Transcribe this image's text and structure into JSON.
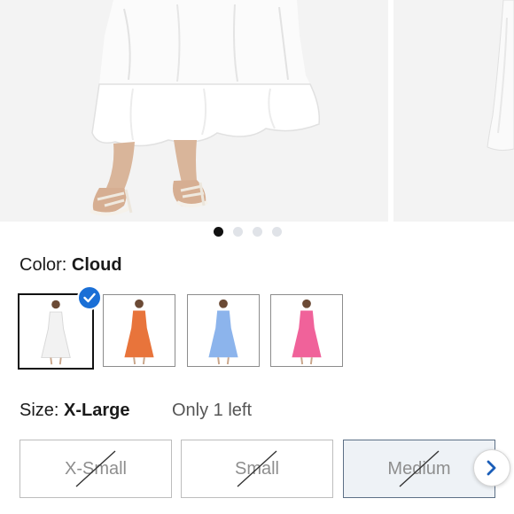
{
  "gallery": {
    "dots": [
      {
        "active": true
      },
      {
        "active": false
      },
      {
        "active": false
      },
      {
        "active": false
      }
    ]
  },
  "color": {
    "label": "Color:",
    "value": "Cloud",
    "swatches": [
      {
        "name": "Cloud",
        "color": "#f2f2f2",
        "selected": true
      },
      {
        "name": "Orange",
        "color": "#e8743b",
        "selected": false
      },
      {
        "name": "Blue",
        "color": "#8cb4ec",
        "selected": false
      },
      {
        "name": "Pink",
        "color": "#f0629a",
        "selected": false
      }
    ]
  },
  "size": {
    "label": "Size:",
    "value": "X-Large",
    "stock_note": "Only 1 left",
    "options": [
      {
        "label": "X-Small",
        "unavailable": true,
        "selected": false
      },
      {
        "label": "Small",
        "unavailable": true,
        "selected": false
      },
      {
        "label": "Medium",
        "unavailable": true,
        "selected": true
      }
    ]
  },
  "icons": {
    "check": "check-icon",
    "next": "chevron-right-icon"
  },
  "colors": {
    "accent": "#1a6fd6",
    "text": "#1a1a1a",
    "muted": "#8e8e8e"
  }
}
